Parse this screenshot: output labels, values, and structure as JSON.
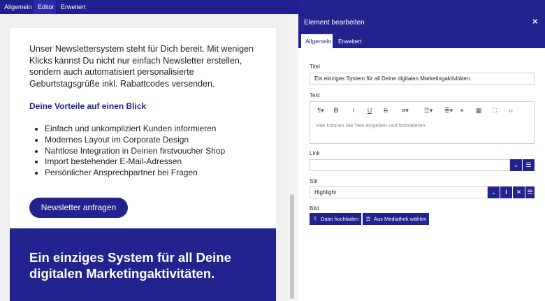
{
  "top_tabs": [
    "Allgemein",
    "Editor",
    "Erweitert"
  ],
  "content": {
    "intro": "Unser Newslettersystem steht für Dich bereit. Mit wenigen Klicks kannst Du nicht nur einfach Newsletter erstellen, sondern auch automatisiert personalisierte Geburtstagsgrüße inkl. Rabattcodes versenden.",
    "subheading": "Deine Vorteile auf einen Blick",
    "benefits": [
      "Einfach und unkompliziert Kunden informieren",
      "Modernes Layout im Corporate Design",
      "Nahtlose Integration in Deinen firstvoucher Shop",
      "Import bestehender E-Mail-Adressen",
      "Persönlicher Ansprechpartner bei Fragen"
    ],
    "cta_label": "Newsletter anfragen",
    "banner_text": "Ein einziges System für all Deine digitalen Marketingaktivitäten."
  },
  "panel": {
    "title": "Element bearbeiten",
    "close_icon": "×",
    "tabs": [
      "Allgemein",
      "Erweitert"
    ],
    "fields": {
      "title_label": "Titel",
      "title_value": "Ein einziges System für all Deine digitalen Marketingaktivitäten.",
      "text_label": "Text",
      "text_placeholder": "Hier können Sie Text eingeben und formatieren",
      "link_label": "Link",
      "link_value": "",
      "style_label": "Stil",
      "style_value": "Highlight",
      "image_label": "Bild",
      "upload_label": "Datei hochladen",
      "media_label": "Aus Mediathek wählen"
    },
    "toolbar_icons": [
      "paragraph-icon",
      "bold-icon",
      "italic-icon",
      "underline-icon",
      "strikethrough-icon",
      "ordered-list-icon",
      "unordered-list-icon",
      "align-icon",
      "link-icon",
      "table-icon",
      "fullscreen-icon",
      "code-view-icon"
    ]
  },
  "colors": {
    "primary": "#23238f",
    "top_bar": "#1f1f8f"
  }
}
